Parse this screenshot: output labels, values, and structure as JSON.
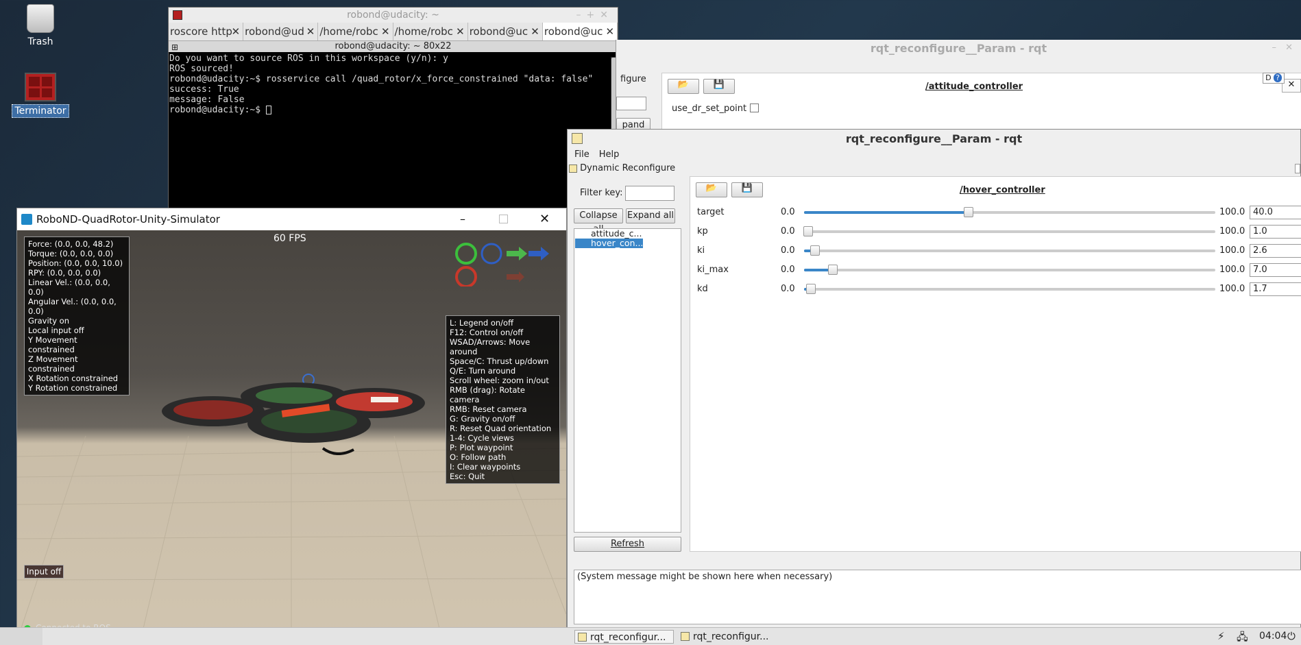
{
  "desktop": {
    "icons": [
      {
        "label": "Trash",
        "selected": false
      },
      {
        "label": "Terminator",
        "selected": true
      }
    ]
  },
  "terminal": {
    "title": "robond@udacity: ~",
    "tabs": [
      {
        "label": "roscore http"
      },
      {
        "label": "robond@ud"
      },
      {
        "label": "/home/robc"
      },
      {
        "label": "/home/robc"
      },
      {
        "label": "robond@uc"
      },
      {
        "label": "robond@uc"
      }
    ],
    "subtitle": "robond@udacity: ~ 80x22",
    "lines": [
      "Do you want to source ROS in this workspace (y/n): y",
      "ROS sourced!",
      "robond@udacity:~$ rosservice call /quad_rotor/x_force_constrained \"data: false\"",
      "success: True",
      "message: False",
      "robond@udacity:~$ "
    ]
  },
  "rqt_back": {
    "title": "rqt_reconfigure__Param - rqt",
    "partial_label": "figure",
    "expand_partial": "pand all",
    "node_title": "/attitude_controller",
    "checkbox_label": "use_dr_set_point"
  },
  "rqt": {
    "title": "rqt_reconfigure__Param - rqt",
    "menu": {
      "file": "File",
      "help": "Help"
    },
    "plugin_label": "Dynamic Reconfigure",
    "filter_label": "Filter key:",
    "filter_value": "",
    "collapse_all": "Collapse all",
    "expand_all": "Expand all",
    "tree": [
      {
        "label": "attitude_c...",
        "selected": false
      },
      {
        "label": "hover_con...",
        "selected": true
      }
    ],
    "refresh": "Refresh",
    "node_title": "/hover_controller",
    "params": [
      {
        "name": "target",
        "min": "0.0",
        "max": "100.0",
        "value": "40.0",
        "level": 0.4
      },
      {
        "name": "kp",
        "min": "0.0",
        "max": "100.0",
        "value": "1.0",
        "level": 0.01
      },
      {
        "name": "ki",
        "min": "0.0",
        "max": "100.0",
        "value": "2.6",
        "level": 0.026
      },
      {
        "name": "ki_max",
        "min": "0.0",
        "max": "100.0",
        "value": "7.0",
        "level": 0.07
      },
      {
        "name": "kd",
        "min": "0.0",
        "max": "100.0",
        "value": "1.7",
        "level": 0.017
      }
    ],
    "system_message": "(System message might be shown here when necessary)"
  },
  "sim": {
    "title": "RoboND-QuadRotor-Unity-Simulator",
    "fps": "60 FPS",
    "status_lines": [
      "Force: (0.0, 0.0, 48.2)",
      "Torque: (0.0, 0.0, 0.0)",
      "Position: (0.0, 0.0, 10.0)",
      "RPY: (0.0, 0.0, 0.0)",
      "Linear Vel.: (0.0, 0.0, 0.0)",
      "Angular Vel.: (0.0, 0.0, 0.0)",
      "Gravity on",
      "Local input off",
      "Y Movement constrained",
      "Z Movement constrained",
      "X Rotation constrained",
      "Y Rotation constrained"
    ],
    "legend_lines": [
      "L: Legend on/off",
      "F12: Control on/off",
      "WSAD/Arrows: Move around",
      "Space/C: Thrust up/down",
      "Q/E: Turn around",
      "Scroll wheel: zoom in/out",
      "RMB (drag): Rotate camera",
      "RMB: Reset camera",
      "G: Gravity on/off",
      "R: Reset Quad orientation",
      "1-4: Cycle views",
      "P: Plot waypoint",
      "O: Follow path",
      "I: Clear waypoints",
      "Esc: Quit"
    ],
    "input_button": "Input off",
    "connection": "Connected to ROS"
  },
  "taskbar": {
    "tasks": [
      {
        "label": "rqt_reconfigur..."
      },
      {
        "label": "rqt_reconfigur..."
      }
    ],
    "clock": "04:04"
  }
}
